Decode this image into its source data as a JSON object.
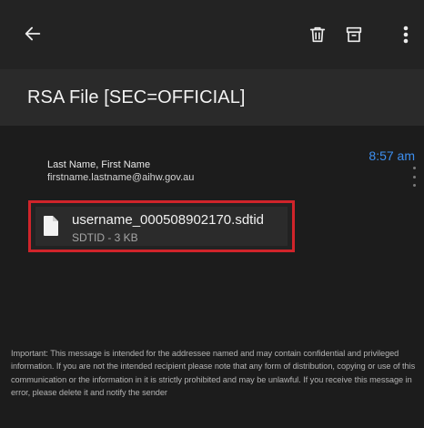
{
  "header": {
    "icons": {
      "back": "arrow-left-icon",
      "delete": "trash-icon",
      "archive": "archive-icon",
      "more": "more-vertical-icon"
    }
  },
  "email": {
    "subject": "RSA File [SEC=OFFICIAL]",
    "time": "8:57 am",
    "sender_name": "Last Name, First Name",
    "sender_email": "firstname.lastname@aihw.gov.au",
    "attachment": {
      "file_name": "username_000508902170.sdtid",
      "meta": "SDTID - 3 KB",
      "icon": "file-icon",
      "highlight_color": "#d0242a"
    },
    "disclaimer": "Important: This message is intended for the addressee named and may contain confidential and privileged information. If you are not the intended recipient please note that any form of distribution, copying or use of this communication or the information in it is strictly prohibited and may be unlawful. If you receive this message in error, please delete it and notify the sender"
  },
  "colors": {
    "accent": "#3d8ff0",
    "background": "#1c1c1c",
    "toolbar": "#232323",
    "title_bar": "#2a2a2a"
  }
}
